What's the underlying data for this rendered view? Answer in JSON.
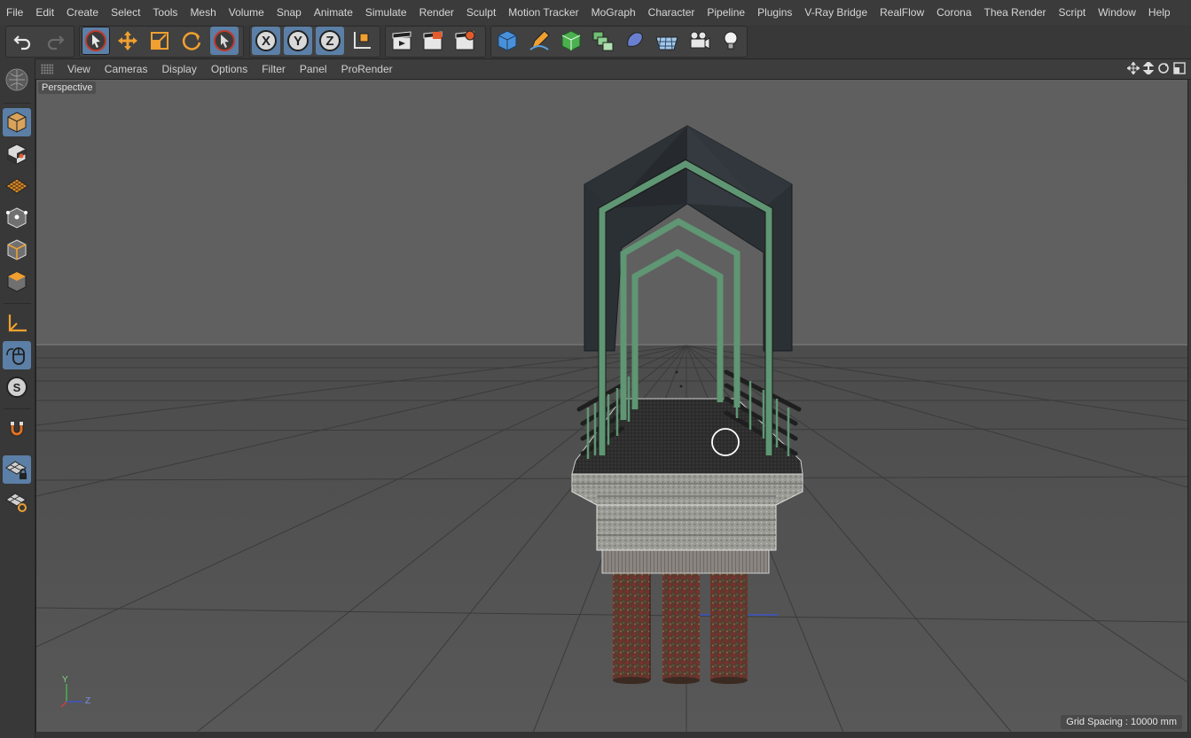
{
  "menu": [
    "File",
    "Edit",
    "Create",
    "Select",
    "Tools",
    "Mesh",
    "Volume",
    "Snap",
    "Animate",
    "Simulate",
    "Render",
    "Sculpt",
    "Motion Tracker",
    "MoGraph",
    "Character",
    "Pipeline",
    "Plugins",
    "V-Ray Bridge",
    "RealFlow",
    "Corona",
    "Thea Render",
    "Script",
    "Window",
    "Help"
  ],
  "toolbar": {
    "axis_x": "X",
    "axis_y": "Y",
    "axis_z": "Z"
  },
  "viewport_menu": [
    "View",
    "Cameras",
    "Display",
    "Options",
    "Filter",
    "Panel",
    "ProRender"
  ],
  "viewport": {
    "camera_label": "Perspective",
    "grid_spacing": "Grid Spacing : 10000 mm",
    "axis_labels": {
      "y": "Y",
      "z": "Z"
    }
  },
  "colors": {
    "accent": "#5b7fa6",
    "icon_orange": "#f0a030",
    "roof": "#2b3034",
    "frame_green": "#5f9673"
  }
}
